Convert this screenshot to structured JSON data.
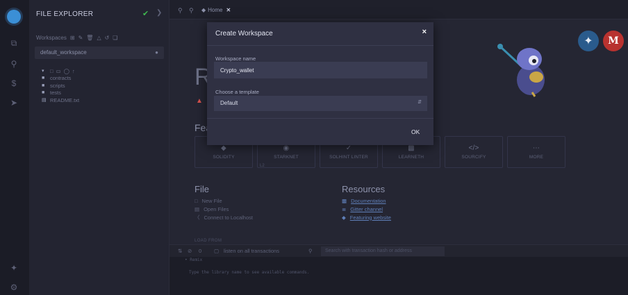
{
  "explorer": {
    "title": "FILE EXPLORER",
    "workspaces_label": "Workspaces",
    "current_workspace": "default_workspace",
    "tree": [
      {
        "name": "contracts",
        "icon": "folder-icon"
      },
      {
        "name": "scripts",
        "icon": "folder-icon"
      },
      {
        "name": "tests",
        "icon": "folder-icon"
      },
      {
        "name": "README.txt",
        "icon": "file-icon"
      }
    ]
  },
  "tabs": {
    "home_label": "Home"
  },
  "home": {
    "heading_fragment": "R",
    "features_fragment": "Fea",
    "features": [
      {
        "label": "SOLIDITY",
        "icon": "solidity-icon"
      },
      {
        "label": "STARKNET",
        "icon": "starknet-icon"
      },
      {
        "label": "SOLHINT LINTER",
        "icon": "linter-icon"
      },
      {
        "label": "LEARNETH",
        "icon": "learneth-icon"
      },
      {
        "label": "SOURCIFY",
        "icon": "sourcify-icon"
      },
      {
        "label": "MORE",
        "icon": "more-icon"
      }
    ],
    "features_sub": "L2",
    "file_heading": "File",
    "file_actions": [
      "New File",
      "Open Files",
      "Connect to Localhost"
    ],
    "load_from": "LOAD FROM",
    "resources_heading": "Resources",
    "resources": [
      "Documentation",
      "Gitter channel",
      "Featuring website"
    ]
  },
  "terminal": {
    "count": "0",
    "listen_label": "listen on all transactions",
    "search_placeholder": "Search with transaction hash or address",
    "line1": "• Remix",
    "line2": "Type the library name to see available commands."
  },
  "modal": {
    "title": "Create Workspace",
    "close_symbol": "×",
    "name_label": "Workspace name",
    "name_value": "Crypto_wallet",
    "template_label": "Choose a template",
    "template_value": "Default",
    "ok_label": "OK"
  },
  "colors": {
    "accent_blue": "#3b8fd6",
    "check_green": "#3fb950",
    "warn_red": "#d9534f"
  }
}
